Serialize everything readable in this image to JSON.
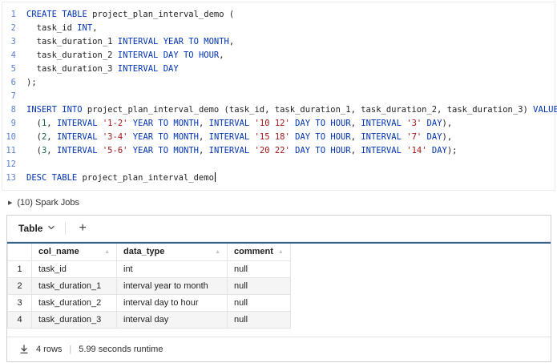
{
  "colors": {
    "keyword": "#0033b3",
    "string": "#a31515",
    "number": "#116644",
    "line_number": "#5b7fd0",
    "table_top_border": "#33628c",
    "alt_row": "#f5f5f5"
  },
  "icons": {
    "collapsed_arrow": "▶",
    "sort": "▲",
    "plus": "+"
  },
  "editor": {
    "lines": [
      {
        "num": "1",
        "segs": [
          [
            "k",
            "CREATE TABLE"
          ],
          [
            "p",
            " project_plan_interval_demo ("
          ]
        ]
      },
      {
        "num": "2",
        "segs": [
          [
            "p",
            "  task_id "
          ],
          [
            "k",
            "INT"
          ],
          [
            "p",
            ","
          ]
        ]
      },
      {
        "num": "3",
        "segs": [
          [
            "p",
            "  task_duration_1 "
          ],
          [
            "k",
            "INTERVAL YEAR TO MONTH"
          ],
          [
            "p",
            ","
          ]
        ]
      },
      {
        "num": "4",
        "segs": [
          [
            "p",
            "  task_duration_2 "
          ],
          [
            "k",
            "INTERVAL DAY TO HOUR"
          ],
          [
            "p",
            ","
          ]
        ]
      },
      {
        "num": "5",
        "segs": [
          [
            "p",
            "  task_duration_3 "
          ],
          [
            "k",
            "INTERVAL DAY"
          ]
        ]
      },
      {
        "num": "6",
        "segs": [
          [
            "p",
            ");"
          ]
        ]
      },
      {
        "num": "7",
        "segs": []
      },
      {
        "num": "8",
        "segs": [
          [
            "k",
            "INSERT INTO"
          ],
          [
            "p",
            " project_plan_interval_demo (task_id, task_duration_1, task_duration_2, task_duration_3) "
          ],
          [
            "k",
            "VALUES"
          ]
        ]
      },
      {
        "num": "9",
        "segs": [
          [
            "p",
            "  ("
          ],
          [
            "n",
            "1"
          ],
          [
            "p",
            ", "
          ],
          [
            "k",
            "INTERVAL"
          ],
          [
            "p",
            " "
          ],
          [
            "s",
            "'1-2'"
          ],
          [
            "p",
            " "
          ],
          [
            "k",
            "YEAR TO MONTH"
          ],
          [
            "p",
            ", "
          ],
          [
            "k",
            "INTERVAL"
          ],
          [
            "p",
            " "
          ],
          [
            "s",
            "'10 12'"
          ],
          [
            "p",
            " "
          ],
          [
            "k",
            "DAY TO HOUR"
          ],
          [
            "p",
            ", "
          ],
          [
            "k",
            "INTERVAL"
          ],
          [
            "p",
            " "
          ],
          [
            "s",
            "'3'"
          ],
          [
            "p",
            " "
          ],
          [
            "k",
            "DAY"
          ],
          [
            "p",
            "),"
          ]
        ]
      },
      {
        "num": "10",
        "segs": [
          [
            "p",
            "  ("
          ],
          [
            "n",
            "2"
          ],
          [
            "p",
            ", "
          ],
          [
            "k",
            "INTERVAL"
          ],
          [
            "p",
            " "
          ],
          [
            "s",
            "'3-4'"
          ],
          [
            "p",
            " "
          ],
          [
            "k",
            "YEAR TO MONTH"
          ],
          [
            "p",
            ", "
          ],
          [
            "k",
            "INTERVAL"
          ],
          [
            "p",
            " "
          ],
          [
            "s",
            "'15 18'"
          ],
          [
            "p",
            " "
          ],
          [
            "k",
            "DAY TO HOUR"
          ],
          [
            "p",
            ", "
          ],
          [
            "k",
            "INTERVAL"
          ],
          [
            "p",
            " "
          ],
          [
            "s",
            "'7'"
          ],
          [
            "p",
            " "
          ],
          [
            "k",
            "DAY"
          ],
          [
            "p",
            "),"
          ]
        ]
      },
      {
        "num": "11",
        "segs": [
          [
            "p",
            "  ("
          ],
          [
            "n",
            "3"
          ],
          [
            "p",
            ", "
          ],
          [
            "k",
            "INTERVAL"
          ],
          [
            "p",
            " "
          ],
          [
            "s",
            "'5-6'"
          ],
          [
            "p",
            " "
          ],
          [
            "k",
            "YEAR TO MONTH"
          ],
          [
            "p",
            ", "
          ],
          [
            "k",
            "INTERVAL"
          ],
          [
            "p",
            " "
          ],
          [
            "s",
            "'20 22'"
          ],
          [
            "p",
            " "
          ],
          [
            "k",
            "DAY TO HOUR"
          ],
          [
            "p",
            ", "
          ],
          [
            "k",
            "INTERVAL"
          ],
          [
            "p",
            " "
          ],
          [
            "s",
            "'14'"
          ],
          [
            "p",
            " "
          ],
          [
            "k",
            "DAY"
          ],
          [
            "p",
            ");"
          ]
        ]
      },
      {
        "num": "12",
        "segs": []
      },
      {
        "num": "13",
        "segs": [
          [
            "k",
            "DESC TABLE"
          ],
          [
            "p",
            " project_plan_interval_demo"
          ]
        ],
        "cursor": true
      }
    ]
  },
  "spark_jobs": {
    "label": "(10) Spark Jobs"
  },
  "results": {
    "tab_label": "Table",
    "add_label": "+",
    "table": {
      "columns": [
        "col_name",
        "data_type",
        "comment"
      ],
      "rows": [
        [
          "1",
          "task_id",
          "int",
          "null"
        ],
        [
          "2",
          "task_duration_1",
          "interval year to month",
          "null"
        ],
        [
          "3",
          "task_duration_2",
          "interval day to hour",
          "null"
        ],
        [
          "4",
          "task_duration_3",
          "interval day",
          "null"
        ]
      ]
    },
    "footer": {
      "rows_label": "4 rows",
      "divider": "|",
      "runtime": "5.99 seconds runtime"
    }
  }
}
